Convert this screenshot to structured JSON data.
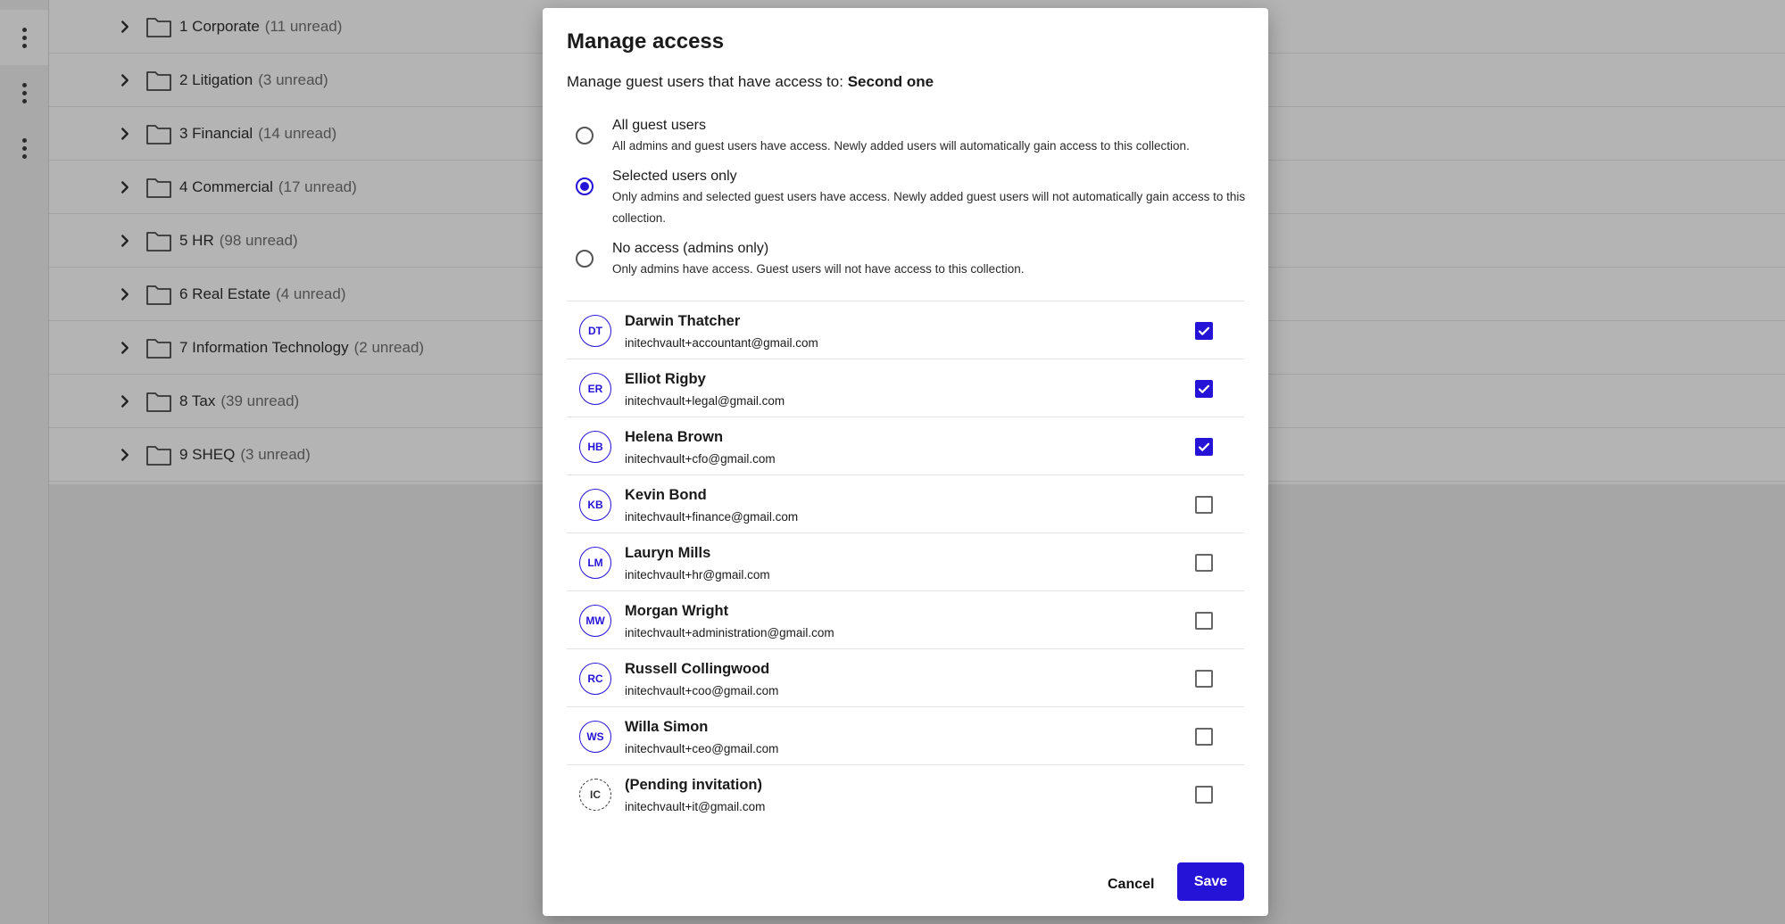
{
  "left_rail": {
    "menu_icons": [
      "more-vertical-icon",
      "more-vertical-icon",
      "more-vertical-icon"
    ]
  },
  "folders": [
    {
      "name": "1 Corporate",
      "unread": "(11 unread)"
    },
    {
      "name": "2 Litigation",
      "unread": "(3 unread)"
    },
    {
      "name": "3 Financial",
      "unread": "(14 unread)"
    },
    {
      "name": "4 Commercial",
      "unread": "(17 unread)"
    },
    {
      "name": "5 HR",
      "unread": "(98 unread)"
    },
    {
      "name": "6 Real Estate",
      "unread": "(4 unread)"
    },
    {
      "name": "7 Information Technology",
      "unread": "(2 unread)"
    },
    {
      "name": "8 Tax",
      "unread": "(39 unread)"
    },
    {
      "name": "9 SHEQ",
      "unread": "(3 unread)"
    }
  ],
  "modal": {
    "title": "Manage access",
    "subtitle_prefix": "Manage guest users that have access to:",
    "collection_name": "Second one",
    "options": [
      {
        "label": "All guest users",
        "desc": "All admins and guest users have access. Newly added users will automatically gain access to this collection.",
        "checked": false
      },
      {
        "label": "Selected users only",
        "desc": "Only admins and selected guest users have access. Newly added guest users will not automatically gain access to this collection.",
        "checked": true
      },
      {
        "label": "No access (admins only)",
        "desc": "Only admins have access. Guest users will not have access to this collection.",
        "checked": false
      }
    ],
    "users": [
      {
        "initials": "DT",
        "name": "Darwin Thatcher",
        "email": "initechvault+accountant@gmail.com",
        "checked": true
      },
      {
        "initials": "ER",
        "name": "Elliot Rigby",
        "email": "initechvault+legal@gmail.com",
        "checked": true
      },
      {
        "initials": "HB",
        "name": "Helena Brown",
        "email": "initechvault+cfo@gmail.com",
        "checked": true
      },
      {
        "initials": "KB",
        "name": "Kevin Bond",
        "email": "initechvault+finance@gmail.com",
        "checked": false
      },
      {
        "initials": "LM",
        "name": "Lauryn Mills",
        "email": "initechvault+hr@gmail.com",
        "checked": false
      },
      {
        "initials": "MW",
        "name": "Morgan Wright",
        "email": "initechvault+administration@gmail.com",
        "checked": false
      },
      {
        "initials": "RC",
        "name": "Russell Collingwood",
        "email": "initechvault+coo@gmail.com",
        "checked": false
      },
      {
        "initials": "WS",
        "name": "Willa Simon",
        "email": "initechvault+ceo@gmail.com",
        "checked": false
      },
      {
        "initials": "IC",
        "name": "(Pending invitation)",
        "email": "initechvault+it@gmail.com",
        "checked": false,
        "pending": true
      }
    ],
    "cancel_label": "Cancel",
    "save_label": "Save"
  },
  "colors": {
    "accent": "#2613d8",
    "overlay": "#a6a6a6"
  }
}
